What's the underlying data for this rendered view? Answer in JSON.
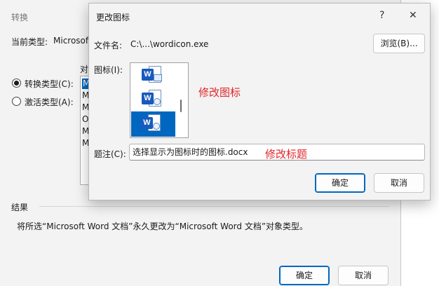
{
  "back_window": {
    "title": "转换",
    "current_type_label": "当前类型:",
    "current_type_value": "Microsoft",
    "radio_convert": "转换类型(C):",
    "radio_activate": "激活类型(A):",
    "list_header_partial": "对",
    "list_items": [
      "M",
      "M",
      "M",
      "O",
      "M",
      "M"
    ],
    "result_label": "结果",
    "result_text": "将所选“Microsoft Word 文档”永久更改为“Microsoft Word 文档”对象类型。",
    "ok_label": "确定",
    "cancel_label": "取消"
  },
  "dialog": {
    "title": "更改图标",
    "help_glyph": "?",
    "close_glyph": "✕",
    "filename_label": "文件名:",
    "filename_value": "C:\\...\\wordicon.exe",
    "browse_label": "浏览(B)...",
    "icon_label": "图标(I):",
    "icons": [
      "word-doc-image-icon",
      "word-doc-globe-icon",
      "word-doc-selected-icon"
    ],
    "selected_icon_index": 2,
    "caption_label": "题注(C):",
    "caption_value": "选择显示为图标时的图标.docx",
    "ok_label": "确定",
    "cancel_label": "取消"
  },
  "annotations": {
    "modify_icon": "修改图标",
    "modify_caption": "修改标题"
  },
  "colors": {
    "accent": "#0067c0",
    "word_blue": "#185abd",
    "annotation_red": "#e0262a"
  }
}
